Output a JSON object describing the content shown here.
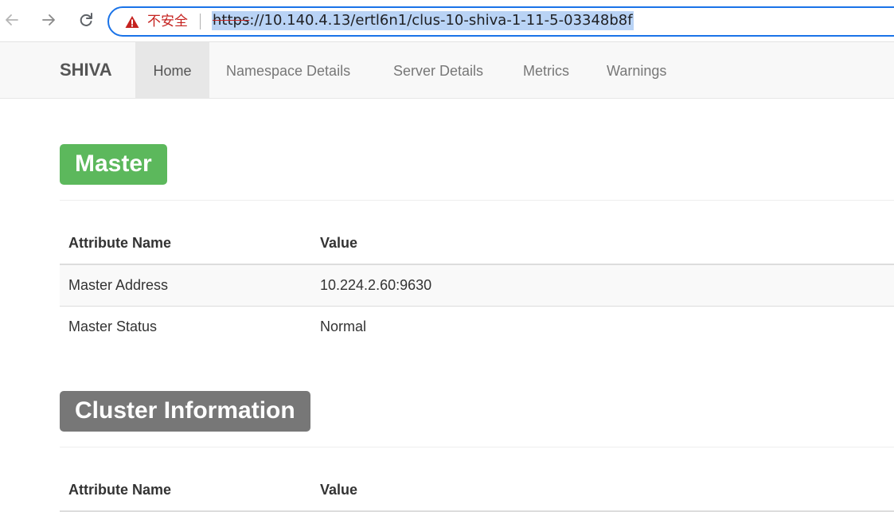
{
  "browser": {
    "back_icon": "arrow-left-icon",
    "forward_icon": "arrow-right-icon",
    "reload_icon": "reload-icon",
    "security_icon": "warning-triangle-icon",
    "security_text": "不安全",
    "url_scheme": "https",
    "url_rest": "://10.140.4.13/ertl6n1/clus-10-shiva-1-11-5-03348b8f",
    "accent_color": "#1a73e8",
    "warning_color": "#c5221f"
  },
  "navbar": {
    "brand": "SHIVA",
    "items": [
      {
        "label": "Home",
        "active": true
      },
      {
        "label": "Namespace Details",
        "active": false
      },
      {
        "label": "Server Details",
        "active": false
      },
      {
        "label": "Metrics",
        "active": false
      },
      {
        "label": "Warnings",
        "active": false
      }
    ]
  },
  "master": {
    "title": "Master",
    "title_color": "#5cb85c",
    "headers": [
      "Attribute Name",
      "Value"
    ],
    "rows": [
      {
        "name": "Master Address",
        "value": "10.224.2.60:9630"
      },
      {
        "name": "Master Status",
        "value": "Normal"
      }
    ]
  },
  "cluster": {
    "title": "Cluster Information",
    "title_color": "#777777",
    "headers": [
      "Attribute Name",
      "Value"
    ]
  }
}
